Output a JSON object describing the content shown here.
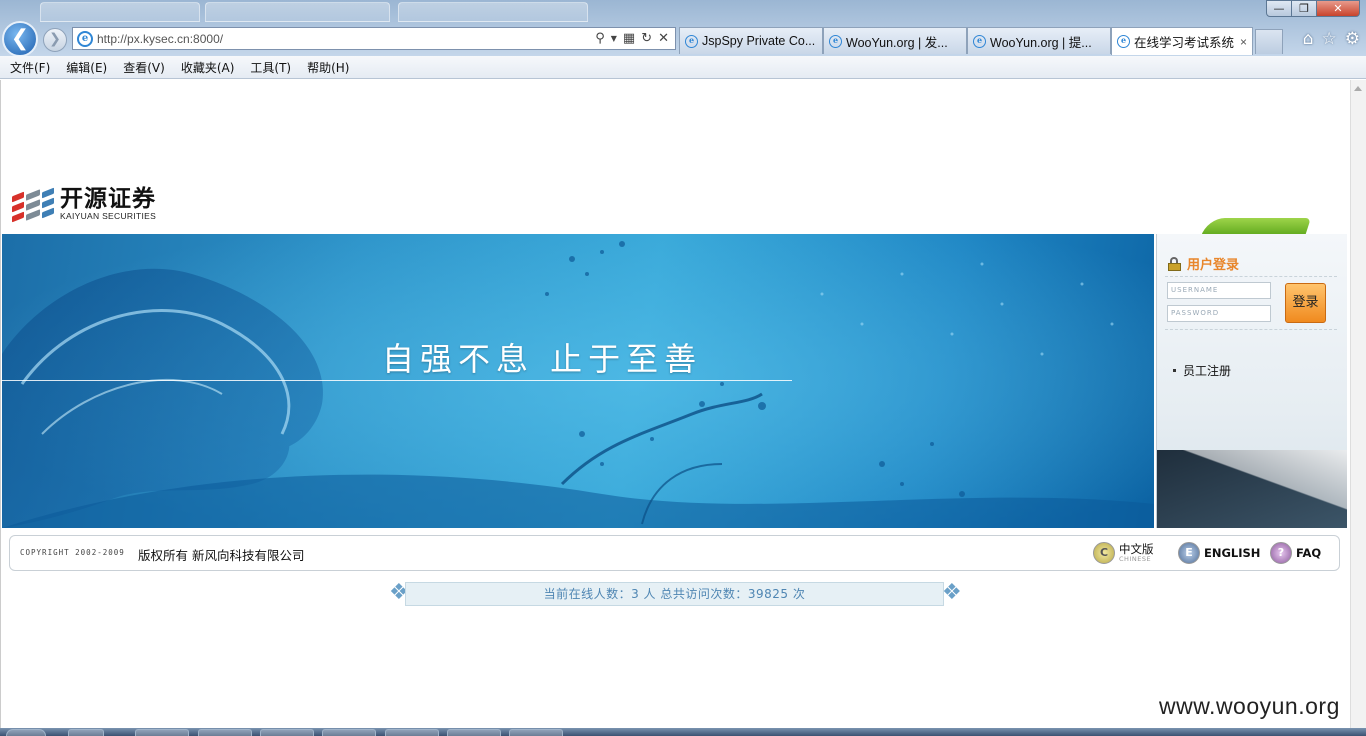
{
  "browser": {
    "url": "http://px.kysec.cn:8000/",
    "tabs": [
      {
        "label": "JspSpy Private Co...",
        "active": false
      },
      {
        "label": "WooYun.org | 发...",
        "active": false
      },
      {
        "label": "WooYun.org | 提...",
        "active": false
      },
      {
        "label": "在线学习考试系统",
        "active": true
      }
    ],
    "tab_close": "×",
    "menu": [
      "文件(F)",
      "编辑(E)",
      "查看(V)",
      "收藏夹(A)",
      "工具(T)",
      "帮助(H)"
    ],
    "window_buttons": {
      "minimize": "—",
      "maximize": "❐",
      "close": "✕"
    },
    "icons": [
      "back-icon",
      "forward-icon",
      "ie-icon",
      "search-icon",
      "refresh-icon",
      "stop-icon",
      "home-icon",
      "favorites-star-icon",
      "gear-icon"
    ]
  },
  "logo": {
    "name_cn": "开源证券",
    "name_en": "KAIYUAN SECURITIES",
    "colors": [
      "#d7312a",
      "#7d8b96",
      "#3f7fb5"
    ]
  },
  "banner": {
    "slogan": "自强不息  止于至善"
  },
  "login": {
    "title": "用户登录",
    "username_placeholder": "USERNAME",
    "password_placeholder": "PASSWORD",
    "submit_label": "登录",
    "register_link": "员工注册"
  },
  "footer": {
    "copyright_en": "COPYRIGHT 2002-2009",
    "copyright_cn": "版权所有  新风向科技有限公司",
    "lang_chinese": "中文版",
    "lang_chinese_sub": "CHINESE",
    "lang_chinese_icon": "C",
    "lang_english": "ENGLISH",
    "lang_english_icon": "E",
    "faq": "FAQ",
    "faq_icon": "?"
  },
  "stats": {
    "text": "当前在线人数：3 人  总共访问次数：39825 次"
  },
  "watermark": "www.wooyun.org",
  "colors": {
    "accent_orange": "#e8862b",
    "banner_blue": "#2d93c9",
    "stats_text": "#4f86b3"
  }
}
